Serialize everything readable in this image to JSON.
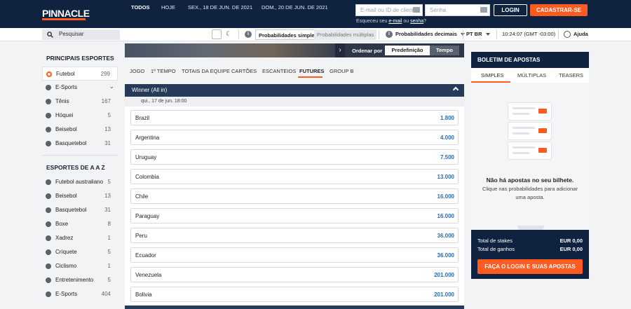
{
  "header": {
    "logo": "PINNACLE",
    "email_placeholder": "E-mail ou ID de cliente",
    "password_placeholder": "Senha",
    "login_label": "LOGIN",
    "signup_label": "CADASTRAR-SE",
    "forgot_prefix": "Esqueceu seu ",
    "forgot_email": "e-mail",
    "forgot_or": " ou ",
    "forgot_password": "senha",
    "forgot_suffix": "?"
  },
  "toolbar": {
    "search_placeholder": "Pesquisar",
    "odds_simple": "Probabilidades simples",
    "odds_multiple": "Probabilidades múltiplas",
    "odds_format": "Probabilidades decimais",
    "language": "PT BR",
    "time": "10:24:07 (GMT -03:00)",
    "help": "Ajuda"
  },
  "sidebar": {
    "main_title": "PRINCIPAIS ESPORTES",
    "main_items": [
      {
        "label": "Futebol",
        "count": "299"
      },
      {
        "label": "E-Sports",
        "count": ""
      },
      {
        "label": "Tênis",
        "count": "167"
      },
      {
        "label": "Hóquei",
        "count": "5"
      },
      {
        "label": "Beisebol",
        "count": "13"
      },
      {
        "label": "Basquetebol",
        "count": "31"
      }
    ],
    "az_title": "ESPORTES DE A A Z",
    "az_items": [
      {
        "label": "Futebol australiano",
        "count": "5"
      },
      {
        "label": "Beisebol",
        "count": "13"
      },
      {
        "label": "Basquetebol",
        "count": "31"
      },
      {
        "label": "Boxe",
        "count": "8"
      },
      {
        "label": "Xadrez",
        "count": "1"
      },
      {
        "label": "Críquete",
        "count": "5"
      },
      {
        "label": "Ciclismo",
        "count": "1"
      },
      {
        "label": "Entretenimento",
        "count": "5"
      },
      {
        "label": "E-Sports",
        "count": "404"
      }
    ]
  },
  "dates": {
    "all": "TODOS",
    "today": "HOJE",
    "d1": "SEX., 18 DE JUN. DE 2021",
    "d2": "DOM., 20 DE JUN. DE 2021",
    "order_label": "Ordenar por",
    "order_default": "Predefinição",
    "order_time": "Tempo"
  },
  "tabs": [
    "JOGO",
    "1º TEMPO",
    "TOTAIS DA EQUIPE",
    "CARTÕES",
    "ESCANTEIOS",
    "FUTURES",
    "GROUP B"
  ],
  "market": {
    "title": "Winner (All in)",
    "date": "qui., 17 de jun. 18:00",
    "rows": [
      {
        "team": "Brazil",
        "odds": "1.800"
      },
      {
        "team": "Argentina",
        "odds": "4.000"
      },
      {
        "team": "Uruguay",
        "odds": "7.500"
      },
      {
        "team": "Colombia",
        "odds": "13.000"
      },
      {
        "team": "Chile",
        "odds": "16.000"
      },
      {
        "team": "Paraguay",
        "odds": "16.000"
      },
      {
        "team": "Peru",
        "odds": "36.000"
      },
      {
        "team": "Ecuador",
        "odds": "36.000"
      },
      {
        "team": "Venezuela",
        "odds": "201.000"
      },
      {
        "team": "Bolivia",
        "odds": "201.000"
      }
    ]
  },
  "betslip": {
    "title": "BOLETIM DE APOSTAS",
    "tabs": [
      "SIMPLES",
      "MÚLTIPLAS",
      "TEASERS"
    ],
    "empty_title": "Não há apostas no seu bilhete.",
    "empty_hint": "Clique nas probabilidades para adicionar uma aposta.",
    "total_stakes_label": "Total de stakes",
    "total_stakes_value": "EUR 0,00",
    "total_win_label": "Total de ganhos",
    "total_win_value": "EUR 0,00",
    "cta": "FAÇA O LOGIN E SUAS APOSTAS"
  },
  "colors": {
    "brand_navy": "#0f2341",
    "accent_orange": "#ff5a1f",
    "odds_blue": "#2a6db5"
  }
}
